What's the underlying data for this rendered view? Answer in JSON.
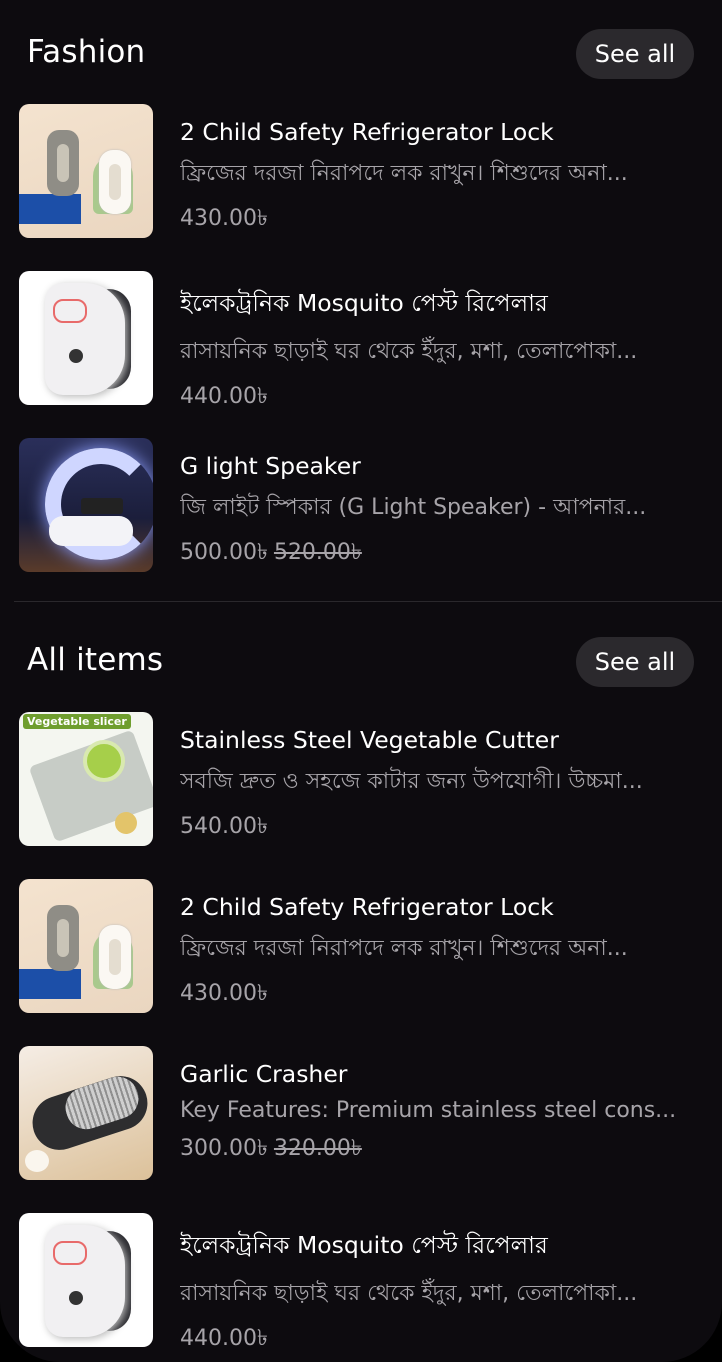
{
  "sections": {
    "fashion": {
      "title": "Fashion",
      "see_all": "See all",
      "items": [
        {
          "name": "2 Child Safety Refrigerator Lock",
          "desc": "ফ্রিজের দরজা নিরাপদে লক রাখুন। শিশুদের অনা...",
          "price": "430.00৳",
          "old_price": ""
        },
        {
          "name": "ইলেকট্রনিক Mosquito পেস্ট রিপেলার",
          "desc": "রাসায়নিক ছাড়াই ঘর থেকে ইঁদুর, মশা, তেলাপোকা...",
          "price": "440.00৳",
          "old_price": ""
        },
        {
          "name": "G light Speaker",
          "desc": "জি লাইট স্পিকার (G Light Speaker) - আপনার...",
          "price": "500.00৳",
          "old_price": "520.00৳"
        }
      ]
    },
    "all_items": {
      "title": "All items",
      "see_all": "See all",
      "items": [
        {
          "name": "Stainless Steel Vegetable Cutter",
          "desc": "সবজি দ্রুত ও সহজে কাটার জন্য উপযোগী।  উচ্চমা...",
          "price": "540.00৳",
          "old_price": "",
          "thumb_label": "Vegetable slicer"
        },
        {
          "name": "2 Child Safety Refrigerator Lock",
          "desc": "ফ্রিজের দরজা নিরাপদে লক রাখুন। শিশুদের অনা...",
          "price": "430.00৳",
          "old_price": ""
        },
        {
          "name": "Garlic Crasher",
          "desc": "Key Features:  Premium stainless steel cons...",
          "price": "300.00৳",
          "old_price": "320.00৳"
        },
        {
          "name": "ইলেকট্রনিক Mosquito পেস্ট রিপেলার",
          "desc": "রাসায়নিক ছাড়াই ঘর থেকে ইঁদুর, মশা, তেলাপোকা...",
          "price": "440.00৳",
          "old_price": ""
        }
      ]
    }
  },
  "colors": {
    "background": "#0d0b0f",
    "button_bg": "#2b292d",
    "muted_text": "#a7a4a9"
  }
}
